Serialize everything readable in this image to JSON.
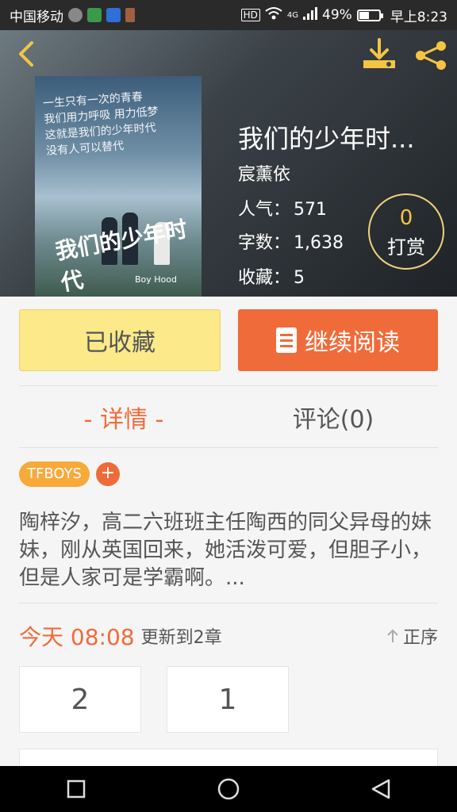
{
  "status_bar": {
    "carrier": "中国移动",
    "network": "HD",
    "signal": "4G",
    "battery": "49%",
    "battery_level": 0.49,
    "time": "早上8:23"
  },
  "header": {
    "cover": {
      "handwriting": "一生只有一次的青春\n我们用力呼吸 用力低梦\n这就是我们的少年时代\n没有人可以替代",
      "title": "我们的少年时代",
      "subtitle": "Boy Hood"
    },
    "book_title": "我们的少年时...",
    "author": "宸薰依",
    "stats": [
      {
        "label": "人气：",
        "value": "571"
      },
      {
        "label": "字数：",
        "value": "1,638"
      },
      {
        "label": "收藏：",
        "value": "5"
      }
    ],
    "reward": {
      "count": "0",
      "label": "打赏"
    }
  },
  "actions": {
    "favorite_label": "已收藏",
    "read_label": "继续阅读"
  },
  "tabs": [
    {
      "label": "- 详情 -",
      "active": true
    },
    {
      "label": "评论(0)",
      "active": false
    }
  ],
  "tags": [
    "TFBOYS"
  ],
  "tag_add": "+",
  "description": "陶梓汐，高二六班班主任陶西的同父异母的妹妹，刚从英国回来，她活泼可爱，但胆子小，但是人家可是学霸啊。...",
  "update": {
    "time": "今天 08:08",
    "info": "更新到2章",
    "order": "正序"
  },
  "chapters": [
    "2",
    "1"
  ],
  "colors": {
    "accent": "#f06b3a",
    "favorite_bg": "#fbe98a",
    "tag_bg": "#f7a93a",
    "gold": "#f4c542"
  }
}
